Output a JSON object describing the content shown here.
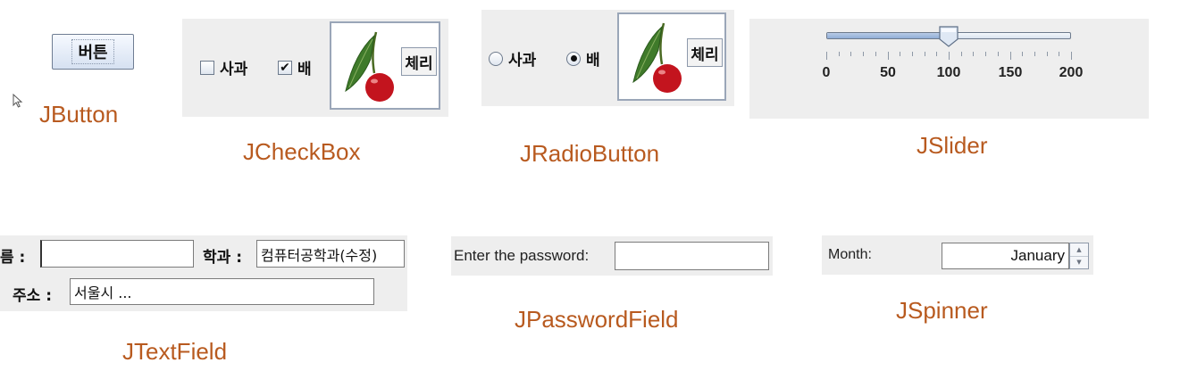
{
  "jbutton": {
    "button_label": "버튼",
    "caption": "JButton"
  },
  "jcheckbox": {
    "items": [
      {
        "label": "사과",
        "checked": false
      },
      {
        "label": "배",
        "checked": true
      }
    ],
    "image_button_label": "체리",
    "caption": "JCheckBox"
  },
  "jradiobutton": {
    "items": [
      {
        "label": "사과",
        "selected": false
      },
      {
        "label": "배",
        "selected": true
      }
    ],
    "image_button_label": "체리",
    "caption": "JRadioButton"
  },
  "jslider": {
    "min": 0,
    "max": 200,
    "value": 100,
    "tick_labels": [
      "0",
      "50",
      "100",
      "150",
      "200"
    ],
    "caption": "JSlider"
  },
  "jtextfield": {
    "name_label": "름 :",
    "name_value": "",
    "dept_label": "학과 :",
    "dept_value": "컴퓨터공학과(수정)",
    "address_label": "주소 :",
    "address_value": "서울시 ...",
    "caption": "JTextField"
  },
  "jpasswordfield": {
    "label": "Enter the password:",
    "value": "",
    "caption": "JPasswordField"
  },
  "jspinner": {
    "label": "Month:",
    "value": "January",
    "caption": "JSpinner"
  },
  "colors": {
    "caption": "#b85a1f",
    "panel": "#eeeeee"
  },
  "icons": [
    "cursor-icon",
    "cherry-icon",
    "checkmark-icon",
    "spinner-up-arrow-icon",
    "spinner-down-arrow-icon"
  ]
}
